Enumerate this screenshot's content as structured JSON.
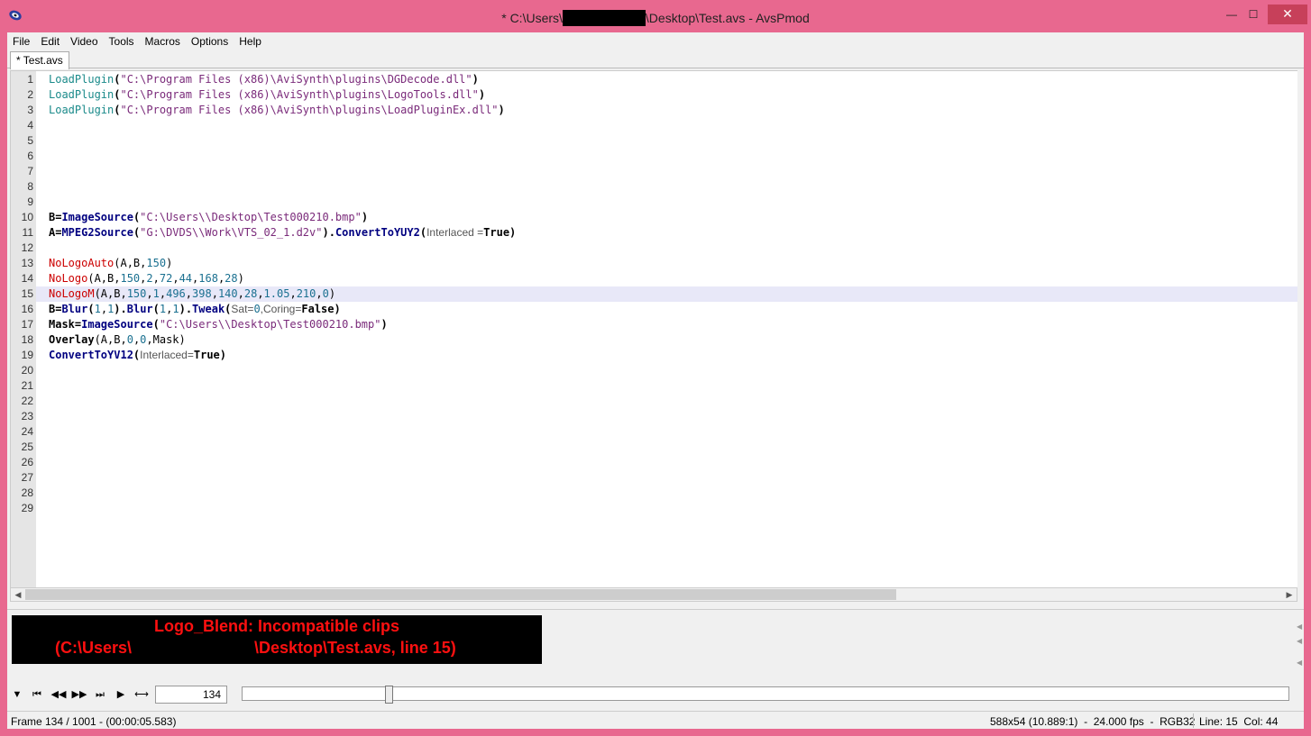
{
  "window": {
    "title_prefix": "* C:\\Users\\",
    "title_suffix": "\\Desktop\\Test.avs - AvsPmod",
    "minimize": "—",
    "maximize": "☐",
    "close": "✕"
  },
  "menu": [
    "File",
    "Edit",
    "Video",
    "Tools",
    "Macros",
    "Options",
    "Help"
  ],
  "tab": {
    "label": "* Test.avs"
  },
  "editor": {
    "line_numbers": [
      "1",
      "2",
      "3",
      "4",
      "5",
      "6",
      "7",
      "8",
      "9",
      "10",
      "11",
      "12",
      "13",
      "14",
      "15",
      "16",
      "17",
      "18",
      "19",
      "20",
      "21",
      "22",
      "23",
      "24",
      "25",
      "26",
      "27",
      "28",
      "29"
    ],
    "highlighted_line": 15,
    "lines": {
      "l1a": "LoadPlugin",
      "l1b": "(",
      "l1c": "\"C:\\Program Files (x86)\\AviSynth\\plugins\\DGDecode.dll\"",
      "l1d": ")",
      "l2a": "LoadPlugin",
      "l2b": "(",
      "l2c": "\"C:\\Program Files (x86)\\AviSynth\\plugins\\LogoTools.dll\"",
      "l2d": ")",
      "l3a": "LoadPlugin",
      "l3b": "(",
      "l3c": "\"C:\\Program Files (x86)\\AviSynth\\plugins\\LoadPluginEx.dll\"",
      "l3d": ")",
      "l10a": "B=",
      "l10b": "ImageSource",
      "l10c": "(",
      "l10d": "\"C:\\Users\\",
      "l10e": "\\Desktop\\Test000210.bmp\"",
      "l10f": ")",
      "l11a": "A=",
      "l11b": "MPEG2Source",
      "l11c": "(",
      "l11d": "\"G:\\DVDS\\",
      "l11e": "\\Work\\VTS_02_1.d2v\"",
      "l11f": ").",
      "l11g": "ConvertToYUY2",
      "l11h": "(",
      "l11i": "Interlaced =",
      "l11j": "True",
      "l11k": ")",
      "l13a": "NoLogoAuto",
      "l13b": "(A,B,",
      "l13c": "150",
      "l13d": ")",
      "l14a": "NoLogo",
      "l14b": "(A,B,",
      "l14c": "150",
      "l14d": ",",
      "l14e": "2",
      "l14f": ",",
      "l14g": "72",
      "l14h": ",",
      "l14i": "44",
      "l14j": ",",
      "l14k": "168",
      "l14l": ",",
      "l14m": "28",
      "l14n": ")",
      "l15a": "NoLogoM",
      "l15b": "(A,B,",
      "l15c": "150",
      "l15d": ",",
      "l15e": "1",
      "l15f": ",",
      "l15g": "496",
      "l15h": ",",
      "l15i": "398",
      "l15j": ",",
      "l15k": "140",
      "l15l": ",",
      "l15m": "28",
      "l15n": ",",
      "l15o": "1.05",
      "l15p": ",",
      "l15q": "210",
      "l15r": ",",
      "l15s": "0",
      "l15t": ")",
      "l16a": "B=",
      "l16b": "Blur",
      "l16c": "(",
      "l16d": "1",
      "l16e": ",",
      "l16f": "1",
      "l16g": ").",
      "l16h": "Blur",
      "l16i": "(",
      "l16j": "1",
      "l16k": ",",
      "l16l": "1",
      "l16m": ").",
      "l16n": "Tweak",
      "l16o": "(",
      "l16p": "Sat=",
      "l16q": "0",
      "l16r": ",Coring=",
      "l16s": "False",
      "l16t": ")",
      "l17a": "Mask=",
      "l17b": "ImageSource",
      "l17c": "(",
      "l17d": "\"C:\\Users\\",
      "l17e": "\\Desktop\\Test000210.bmp\"",
      "l17f": ")",
      "l18a": "Overlay",
      "l18b": "(A,B,",
      "l18c": "0",
      "l18d": ",",
      "l18e": "0",
      "l18f": ",Mask)",
      "l19a": "ConvertToYV12",
      "l19b": "(",
      "l19c": "Interlaced=",
      "l19d": "True",
      "l19e": ")"
    }
  },
  "error": {
    "line1": "Logo_Blend: Incompatible clips",
    "line2_prefix": "(C:\\Users\\",
    "line2_suffix": "\\Desktop\\Test.avs, line 15)"
  },
  "playback": {
    "frame_value": "134",
    "slider_position": 0.134
  },
  "status": {
    "left": "Frame 134 / 1001  -  (00:00:05.583)",
    "middle": "588x54 (10.889:1)  -  24.000 fps  -  RGB32",
    "right": "Line: 15  Col: 44"
  }
}
